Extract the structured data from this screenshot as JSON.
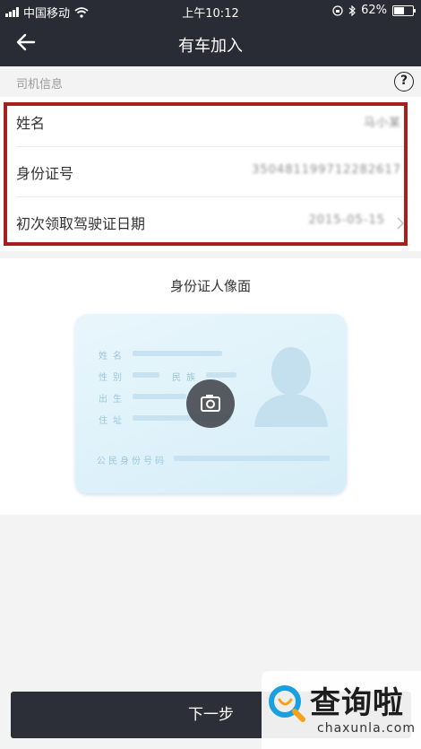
{
  "status_bar": {
    "carrier": "中国移动",
    "time": "上午10:12",
    "battery": "62%",
    "battery_level": 0.62
  },
  "nav": {
    "title": "有车加入",
    "back_icon": "arrow-left-icon"
  },
  "section": {
    "label": "司机信息",
    "help_label": "?"
  },
  "form": {
    "rows": [
      {
        "label": "姓名",
        "value": "马小某"
      },
      {
        "label": "身份证号",
        "value": "350481199712282617"
      },
      {
        "label": "初次领取驾驶证日期",
        "value": "2015-05-15"
      }
    ],
    "highlight_color": "#a8201d"
  },
  "id_card": {
    "title": "身份证人像面",
    "fields": [
      "姓名",
      "性别",
      "民族",
      "出生",
      "住址",
      "公民身份号码"
    ],
    "camera_icon": "camera-icon"
  },
  "footer": {
    "next_label": "下一步"
  },
  "watermark": {
    "brand_cn": "查询啦",
    "brand_en": "chaxunla.com"
  },
  "colors": {
    "header_bg": "#2a2c35",
    "accent_blue": "#1aa0e0",
    "button_bg": "#2d2f38"
  }
}
